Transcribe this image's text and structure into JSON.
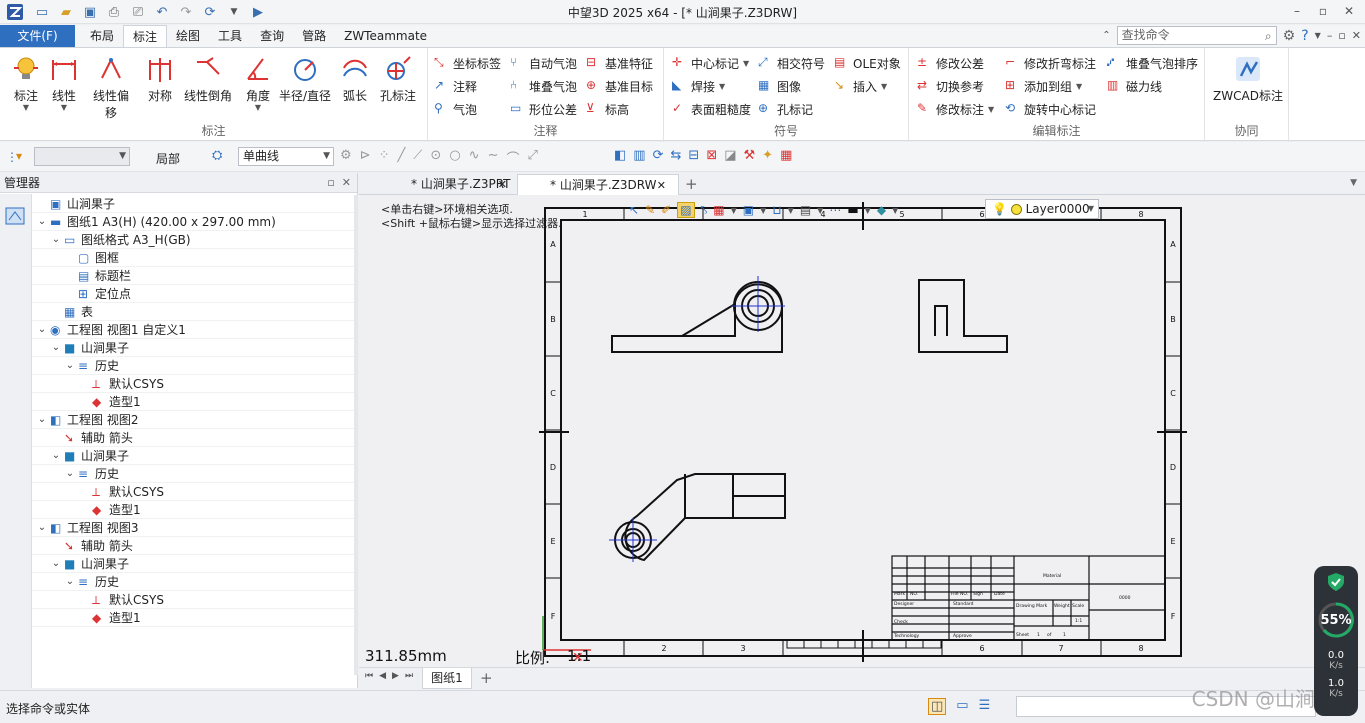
{
  "app": {
    "title": "中望3D 2025 x64 - [* 山涧果子.Z3DRW]",
    "window_controls": [
      "–",
      "▫",
      "✕"
    ]
  },
  "menu": {
    "tabs": [
      "文件(F)",
      "布局",
      "标注",
      "绘图",
      "工具",
      "查询",
      "管路",
      "ZWTeammate"
    ],
    "active_tab": "标注",
    "search_placeholder": "查找命令"
  },
  "ribbon": {
    "groups": {
      "biaozhu": {
        "title": "标注",
        "buttons": [
          "标注",
          "线性",
          "线性偏移",
          "对称",
          "线性倒角",
          "角度",
          "半径/直径",
          "弧长",
          "孔标注"
        ]
      },
      "zhushi": {
        "title": "注释",
        "items": [
          "坐标标签",
          "自动气泡",
          "基准特征",
          "注释",
          "堆叠气泡",
          "基准目标",
          "气泡",
          "形位公差",
          "标高"
        ]
      },
      "fuhao": {
        "title": "符号",
        "items": [
          "中心标记",
          "相交符号",
          "OLE对象",
          "焊接",
          "图像",
          "插入",
          "表面粗糙度",
          "孔标记"
        ]
      },
      "bianji": {
        "title": "编辑标注",
        "items": [
          "修改公差",
          "修改折弯标注",
          "堆叠气泡排序",
          "切换参考",
          "添加到组",
          "磁力线",
          "修改标注",
          "旋转中心标记"
        ]
      },
      "xietong": {
        "title": "协同",
        "button": "ZWCAD标注"
      }
    }
  },
  "toolbar": {
    "local_label": "局部",
    "curve_combo": "单曲线"
  },
  "manager": {
    "title": "管理器",
    "tree": [
      {
        "label": "山涧果子",
        "level": 0,
        "chev": "",
        "icon": "part"
      },
      {
        "label": "图纸1 A3(H) (420.00 x 297.00 mm)",
        "level": 0,
        "chev": "v",
        "icon": "sheet"
      },
      {
        "label": "图纸格式 A3_H(GB)",
        "level": 1,
        "chev": "v",
        "icon": "format"
      },
      {
        "label": "图框",
        "level": 2,
        "chev": "",
        "icon": "frame"
      },
      {
        "label": "标题栏",
        "level": 2,
        "chev": "",
        "icon": "title"
      },
      {
        "label": "定位点",
        "level": 2,
        "chev": "",
        "icon": "anchor"
      },
      {
        "label": "表",
        "level": 1,
        "chev": "",
        "icon": "table"
      },
      {
        "label": "工程图 视图1 自定义1",
        "level": 0,
        "chev": "v",
        "icon": "view1"
      },
      {
        "label": "山涧果子",
        "level": 1,
        "chev": "v",
        "icon": "cube"
      },
      {
        "label": "历史",
        "level": 2,
        "chev": "v",
        "icon": "history"
      },
      {
        "label": "默认CSYS",
        "level": 3,
        "chev": "",
        "icon": "csys"
      },
      {
        "label": "造型1",
        "level": 3,
        "chev": "",
        "icon": "shape"
      },
      {
        "label": "工程图 视图2",
        "level": 0,
        "chev": "v",
        "icon": "view"
      },
      {
        "label": "辅助 箭头",
        "level": 1,
        "chev": "",
        "icon": "arrow"
      },
      {
        "label": "山涧果子",
        "level": 1,
        "chev": "v",
        "icon": "cube"
      },
      {
        "label": "历史",
        "level": 2,
        "chev": "v",
        "icon": "history"
      },
      {
        "label": "默认CSYS",
        "level": 3,
        "chev": "",
        "icon": "csys"
      },
      {
        "label": "造型1",
        "level": 3,
        "chev": "",
        "icon": "shape"
      },
      {
        "label": "工程图 视图3",
        "level": 0,
        "chev": "v",
        "icon": "view"
      },
      {
        "label": "辅助 箭头",
        "level": 1,
        "chev": "",
        "icon": "arrow"
      },
      {
        "label": "山涧果子",
        "level": 1,
        "chev": "v",
        "icon": "cube"
      },
      {
        "label": "历史",
        "level": 2,
        "chev": "v",
        "icon": "history"
      },
      {
        "label": "默认CSYS",
        "level": 3,
        "chev": "",
        "icon": "csys"
      },
      {
        "label": "造型1",
        "level": 3,
        "chev": "",
        "icon": "shape"
      }
    ]
  },
  "doc_tabs": [
    {
      "label": "* 山涧果子.Z3PRT",
      "active": false
    },
    {
      "label": "* 山涧果子.Z3DRW",
      "active": true
    }
  ],
  "canvas": {
    "hint1": "<单击右键>环境相关选项.",
    "hint2": "<Shift +鼠标右键>显示选择过滤器.",
    "layer": "Layer0000",
    "measure": "311.85mm",
    "scale_label": "比例:",
    "scale_value": "1:1",
    "border_cols": [
      "1",
      "2",
      "3",
      "4",
      "5",
      "6",
      "7",
      "8"
    ],
    "border_rows": [
      "A",
      "B",
      "C",
      "D",
      "E",
      "F"
    ],
    "title_block": {
      "mark": "Mark",
      "no": "NO.",
      "file_no": "File NO.",
      "sign": "Sign",
      "date": "Date",
      "designer": "Designer",
      "standard": "Standard",
      "check": "Check",
      "technology": "Technology",
      "approve": "Approve",
      "drawing_mark": "Drawing Mark",
      "weight": "Weight",
      "scale": "Scale",
      "scale_val": "1:1",
      "sheet": "Sheet",
      "of": "of",
      "sheet_no": "1",
      "sheet_total": "1",
      "material": "Material",
      "code": "0000"
    }
  },
  "sheet_tabs": [
    "图纸1"
  ],
  "status": {
    "message": "选择命令或实体"
  },
  "perf": {
    "percent": "55%",
    "up": "0.0",
    "up_unit": "K/s",
    "down": "1.0",
    "down_unit": "K/s"
  },
  "watermark": "CSDN @山涧果子",
  "colors": {
    "accent": "#2f6fc0",
    "drawing": "#111111",
    "centerline": "#2233cc"
  }
}
